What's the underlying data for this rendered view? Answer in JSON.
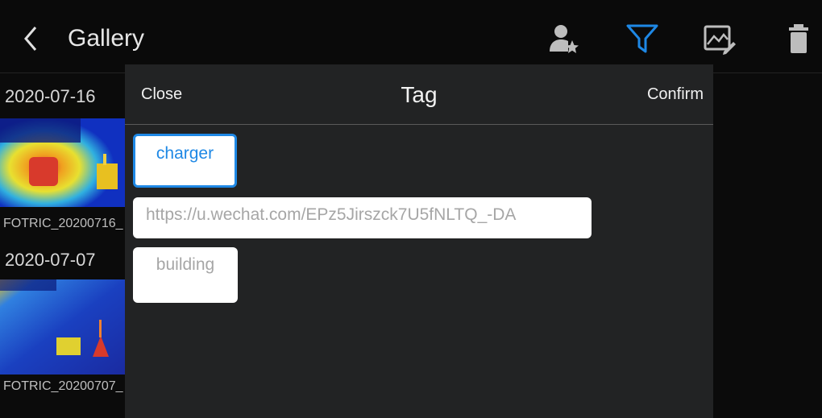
{
  "header": {
    "title": "Gallery",
    "icons": [
      "back-icon",
      "person-star-icon",
      "filter-icon",
      "image-edit-icon",
      "trash-icon"
    ],
    "filter_color": "#1e88e5"
  },
  "gallery": {
    "groups": [
      {
        "date": "2020-07-16",
        "filename": "FOTRIC_20200716_"
      },
      {
        "date": "2020-07-07",
        "filename": "FOTRIC_20200707_"
      }
    ]
  },
  "modal": {
    "close_label": "Close",
    "title": "Tag",
    "confirm_label": "Confirm",
    "tags": [
      {
        "label": "charger",
        "selected": true
      },
      {
        "label": "https://u.wechat.com/EPz5Jirszck7U5fNLTQ_-DA",
        "selected": false
      },
      {
        "label": "building",
        "selected": false
      }
    ],
    "accent": "#1e88e5"
  }
}
